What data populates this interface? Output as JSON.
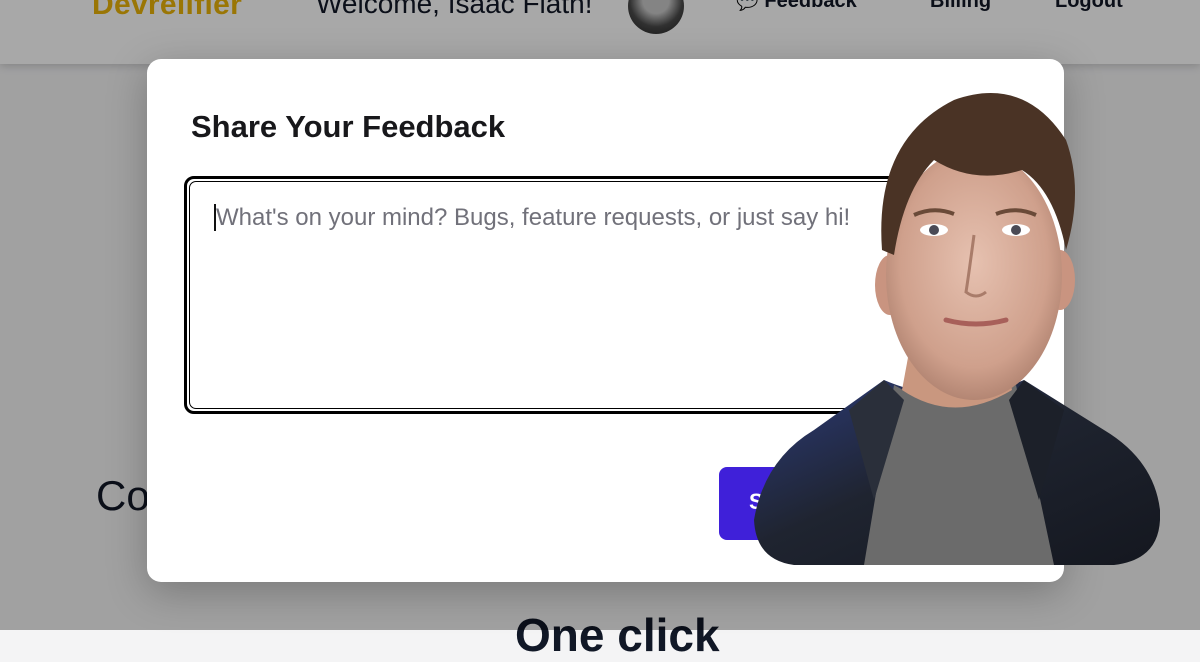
{
  "navbar": {
    "brand": "Devrelifier",
    "welcome": "Welcome, Isaac Flath!",
    "links": [
      {
        "icon": "speech-bubble-icon",
        "label": "Feedback"
      },
      {
        "label": "Billing"
      },
      {
        "label": "Logout"
      }
    ]
  },
  "background": {
    "left_text": "Co",
    "bottom_text": "One click"
  },
  "modal": {
    "title": "Share Your Feedback",
    "textarea": {
      "placeholder": "What's on your mind? Bugs, feature requests, or just say hi!",
      "value": ""
    },
    "submit_label": "Send"
  },
  "colors": {
    "brand": "#eab308",
    "accent": "#3f20d9"
  }
}
